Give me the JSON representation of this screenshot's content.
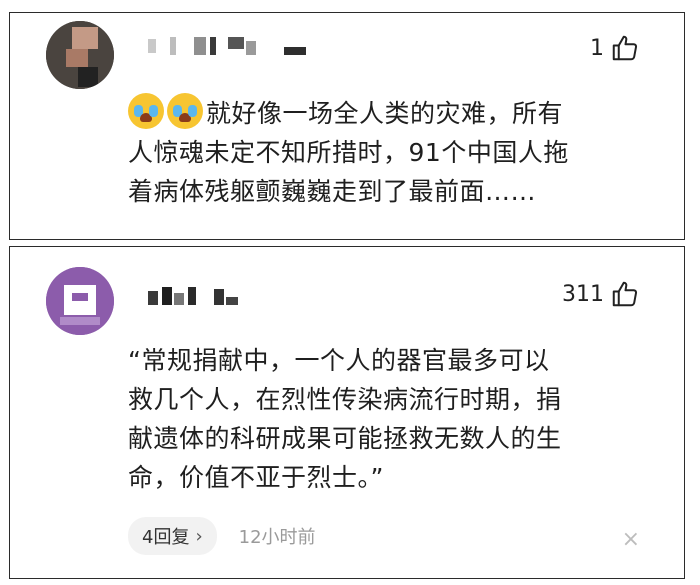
{
  "comments": [
    {
      "likes": "1",
      "emoji_icons": [
        "crying-face-icon",
        "crying-face-icon"
      ],
      "lines": [
        "就好像一场全人类的灾难，所有",
        "人惊魂未定不知所措时，91个中国人拖",
        "着病体残躯颤巍巍走到了最前面……"
      ]
    },
    {
      "likes": "311",
      "lines": [
        "“常规捐献中，一个人的器官最多可以",
        "救几个人，在烈性传染病流行时期，捐",
        "献遗体的科研成果可能拯救无数人的生",
        "命，价值不亚于烈士。”"
      ],
      "reply_label": "4回复",
      "reply_chevron": "›",
      "time": "12小时前",
      "close_symbol": "×"
    }
  ],
  "colors": {
    "text": "#1f1f1f",
    "muted": "#9a9a9a",
    "border": "#2b2b2b",
    "emoji": "#f7c531",
    "tears": "#5bb7ee"
  }
}
